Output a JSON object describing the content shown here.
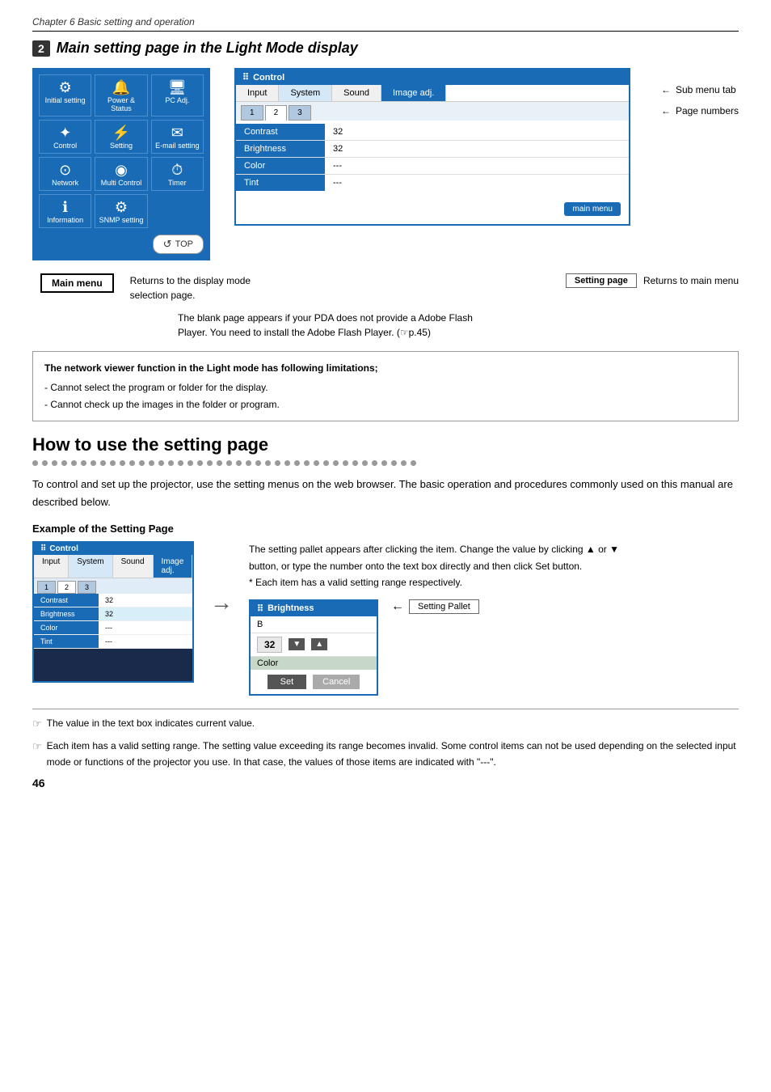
{
  "chapter": {
    "header": "Chapter 6 Basic setting and operation"
  },
  "section1": {
    "num": "2",
    "title": "Main setting page in the Light Mode display",
    "sub_menu_tab_label": "Sub menu tab",
    "page_numbers_label": "Page numbers",
    "main_menu_label": "Main menu",
    "top_button": "TOP",
    "returns_display": "Returns to the display mode selection page.",
    "setting_page_label": "Setting page",
    "returns_main": "Returns to main menu",
    "flash_note": "The blank page appears if your PDA does not provide a Adobe Flash Player. You need to install the Adobe Flash Player. (☞p.45)",
    "control_header": "Control",
    "tabs": [
      {
        "label": "Input",
        "active": false
      },
      {
        "label": "System",
        "active": false
      },
      {
        "label": "Sound",
        "active": false
      },
      {
        "label": "Image adj.",
        "active": true
      }
    ],
    "subtabs": [
      "1",
      "2",
      "3"
    ],
    "rows": [
      {
        "label": "Contrast",
        "value": "32"
      },
      {
        "label": "Brightness",
        "value": "32"
      },
      {
        "label": "Color",
        "value": "---"
      },
      {
        "label": "Tint",
        "value": "---"
      }
    ],
    "main_menu_btn": "main menu",
    "menu_items": [
      {
        "icon": "⚙",
        "label": "Initial setting"
      },
      {
        "icon": "!",
        "label": "Power & Status"
      },
      {
        "icon": "🖥",
        "label": "PC Adj."
      },
      {
        "icon": "✦",
        "label": "Control"
      },
      {
        "icon": "⚡",
        "label": "Setting"
      },
      {
        "icon": "✉",
        "label": "E-mail setting"
      },
      {
        "icon": "⊙",
        "label": "Network"
      },
      {
        "icon": "◉",
        "label": "Multi Control"
      },
      {
        "icon": "⏱",
        "label": "Timer"
      },
      {
        "icon": "ℹ",
        "label": "Information"
      },
      {
        "icon": "⚙",
        "label": "SNMP setting"
      }
    ]
  },
  "warning_box": {
    "title": "The network viewer function in the Light mode has following limitations;",
    "items": [
      "- Cannot select the program or folder for the display.",
      "- Cannot check up the images in the folder or program."
    ]
  },
  "section2": {
    "title": "How to use the setting page",
    "body": "To control and set up the projector, use the setting menus on the web browser. The basic operation and procedures commonly used on this manual are described below.",
    "example_title": "Example of the Setting Page",
    "setting_desc1": "The setting pallet appears after clicking the item. Change the value by clicking ▲ or ▼ button, or type the number onto the text box directly and then click Set button.",
    "setting_desc2": "* Each item has a valid setting range respectively.",
    "setting_pallet_label": "Setting Pallet",
    "pallet_header": "Brightness",
    "pallet_value": "32",
    "pallet_label_b": "B",
    "pallet_label_color": "Color",
    "set_btn": "Set",
    "cancel_btn": "Cancel",
    "control_header": "Control",
    "example_tabs": [
      {
        "label": "Input"
      },
      {
        "label": "System"
      },
      {
        "label": "Sound"
      },
      {
        "label": "Image adj."
      }
    ],
    "example_subtabs": [
      "1",
      "2",
      "3"
    ],
    "example_rows": [
      {
        "label": "Contrast",
        "value": "32"
      },
      {
        "label": "Brightness",
        "value": "32",
        "highlight": true
      },
      {
        "label": "Color",
        "value": "---"
      },
      {
        "label": "Tint",
        "value": "---"
      }
    ]
  },
  "notes": [
    "The value in the text box indicates current value.",
    "Each item has a valid setting range. The setting value exceeding its range becomes invalid. Some control items can not be used depending on the selected input mode or functions of the projector you use. In that case, the values of those items are indicated with \"---\"."
  ],
  "page_number": "46"
}
